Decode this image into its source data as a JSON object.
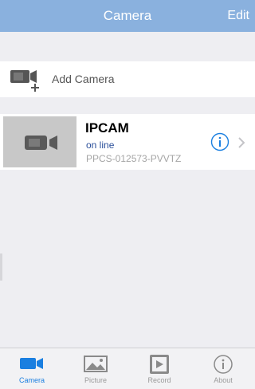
{
  "navbar": {
    "title": "Camera",
    "edit_label": "Edit"
  },
  "add_camera": {
    "label": "Add Camera",
    "icon": "add-camera-icon"
  },
  "cameras": [
    {
      "name": "IPCAM",
      "status": "on line",
      "id": "PPCS-012573-PVVTZ",
      "thumbnail_icon": "video-camera-icon"
    }
  ],
  "tabbar": {
    "tabs": [
      {
        "label": "Camera",
        "icon": "video-camera-icon",
        "active": true
      },
      {
        "label": "Picture",
        "icon": "picture-icon",
        "active": false
      },
      {
        "label": "Record",
        "icon": "record-icon",
        "active": false
      },
      {
        "label": "About",
        "icon": "info-icon",
        "active": false
      }
    ]
  },
  "colors": {
    "navbar": "#8ab1de",
    "accent": "#1a7fe0",
    "status_online": "#2a4f9a",
    "background": "#eeeef2"
  }
}
